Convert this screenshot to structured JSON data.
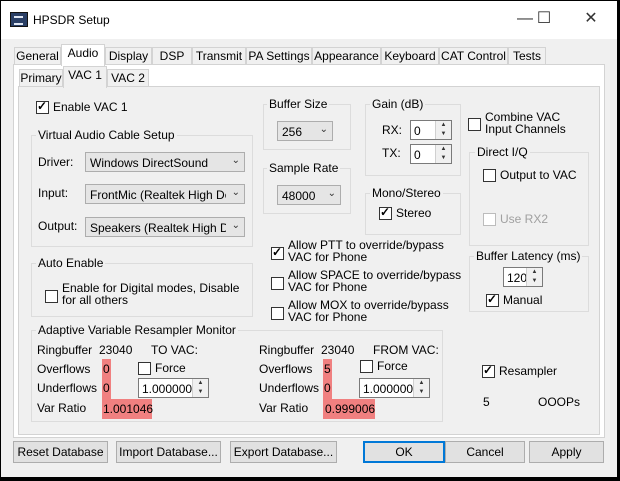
{
  "window": {
    "title": "HPSDR Setup",
    "minimize_glyph": "—",
    "maximize_glyph": "☐",
    "close_glyph": "✕"
  },
  "main_tabs": [
    "General",
    "Audio",
    "Display",
    "DSP",
    "Transmit",
    "PA Settings",
    "Appearance",
    "Keyboard",
    "CAT Control",
    "Tests"
  ],
  "sub_tabs": [
    "Primary",
    "VAC 1",
    "VAC 2"
  ],
  "enable_vac": {
    "label": "Enable VAC 1",
    "checked": true
  },
  "vac_setup": {
    "legend": "Virtual Audio Cable Setup",
    "driver_label": "Driver:",
    "driver_value": "Windows DirectSound",
    "input_label": "Input:",
    "input_value": "FrontMic (Realtek High Defin",
    "output_label": "Output:",
    "output_value": "Speakers (Realtek High Defi"
  },
  "buffer_size": {
    "legend": "Buffer Size",
    "value": "256"
  },
  "sample_rate": {
    "legend": "Sample Rate",
    "value": "48000"
  },
  "gain": {
    "legend": "Gain (dB)",
    "rx_label": "RX:",
    "rx_value": "0",
    "tx_label": "TX:",
    "tx_value": "0"
  },
  "mono_stereo": {
    "legend": "Mono/Stereo",
    "stereo_label": "Stereo",
    "stereo_checked": true
  },
  "combine_vac": {
    "label_line1": "Combine VAC",
    "label_line2": "Input Channels",
    "checked": false
  },
  "direct_iq": {
    "legend": "Direct I/Q",
    "output_label": "Output to VAC",
    "use_rx2_label": "Use RX2"
  },
  "buffer_latency": {
    "legend": "Buffer Latency (ms)",
    "value": "120",
    "manual_label": "Manual",
    "manual_checked": true
  },
  "auto_enable": {
    "legend": "Auto Enable",
    "line1": "Enable for Digital modes, Disable",
    "line2": "for all others"
  },
  "overrides": {
    "ptt": {
      "line1": "Allow PTT to override/bypass",
      "line2": "VAC for Phone",
      "checked": true
    },
    "space": {
      "line1": "Allow SPACE to override/bypass",
      "line2": "VAC for Phone",
      "checked": false
    },
    "mox": {
      "line1": "Allow MOX to override/bypass",
      "line2": "VAC for Phone",
      "checked": false
    }
  },
  "resampler_monitor": {
    "legend": "Adaptive Variable Resampler Monitor",
    "to_vac": {
      "ringbuffer_label": "Ringbuffer",
      "ringbuffer_value": "23040",
      "direction": "TO VAC:",
      "overflows_label": "Overflows",
      "overflows_value": "0",
      "underflows_label": "Underflows",
      "underflows_value": "0",
      "force_label": "Force",
      "force_value": "1.000000",
      "var_ratio_label": "Var Ratio",
      "var_ratio_value": "1.001046"
    },
    "from_vac": {
      "ringbuffer_label": "Ringbuffer",
      "ringbuffer_value": "23040",
      "direction": "FROM VAC:",
      "overflows_label": "Overflows",
      "overflows_value": "5",
      "underflows_label": "Underflows",
      "underflows_value": "0",
      "force_label": "Force",
      "force_value": "1.000000",
      "var_ratio_label": "Var Ratio",
      "var_ratio_value": "0.999006"
    }
  },
  "resampler": {
    "label": "Resampler",
    "checked": true
  },
  "ooops": {
    "count": "5",
    "label": "OOOPs"
  },
  "buttons": {
    "reset": "Reset Database",
    "import": "Import Database...",
    "export": "Export Database...",
    "ok": "OK",
    "cancel": "Cancel",
    "apply": "Apply"
  },
  "colors": {
    "highlight": "#f08080",
    "default_button_border": "#0078d7"
  }
}
